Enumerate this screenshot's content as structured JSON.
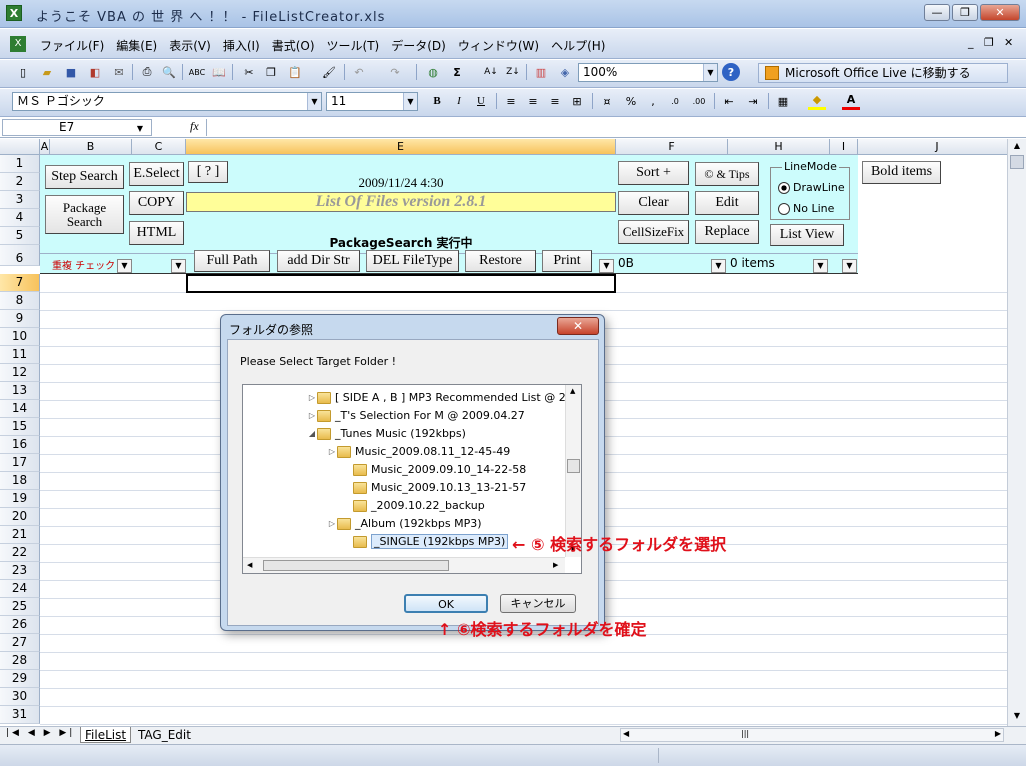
{
  "window": {
    "title": "ようこそ VBA の 世 界 へ ！！ - FileListCreator.xls"
  },
  "menu": [
    "ファイル(F)",
    "編集(E)",
    "表示(V)",
    "挿入(I)",
    "書式(O)",
    "ツール(T)",
    "データ(D)",
    "ウィンドウ(W)",
    "ヘルプ(H)"
  ],
  "toolbar": {
    "zoom": "100%",
    "office_live": "Microsoft Office Live に移動する",
    "font": "ＭＳ Ｐゴシック",
    "size": "11"
  },
  "formula": {
    "cell": "E7"
  },
  "columns": [
    "A",
    "B",
    "C",
    "E",
    "F",
    "H",
    "I",
    "J"
  ],
  "rows": [
    "1",
    "2",
    "3",
    "4",
    "5",
    "6",
    "7",
    "8",
    "9",
    "10",
    "11",
    "12",
    "13",
    "14",
    "15",
    "16",
    "17",
    "18",
    "19",
    "20",
    "21",
    "22",
    "23",
    "24",
    "25",
    "26",
    "27",
    "28",
    "29",
    "30",
    "31"
  ],
  "sheet": {
    "step_search": "Step Search",
    "package_search": "Package Search",
    "eselect": "E.Select",
    "copy": "COPY",
    "html": "HTML",
    "help": "[ ? ]",
    "datetime": "2009/11/24 4:30",
    "title": "List Of Files version 2.8.1",
    "status": "PackageSearch 実行中",
    "sort": "Sort +",
    "tips": "© & Tips",
    "clear": "Clear",
    "edit": "Edit",
    "cellsizefix": "CellSizeFix",
    "replace": "Replace",
    "linemode": "LineMode",
    "drawline": "DrawLine",
    "noline": "No Line",
    "listview": "List View",
    "bold": "Bold items",
    "dup_check": "重複 チェック",
    "fullpath": "Full Path",
    "adddir": "add Dir Str",
    "delfiletype": "DEL FileType",
    "restore": "Restore",
    "print": "Print",
    "size": "0B",
    "items": "0 items"
  },
  "dialog": {
    "title": "フォルダの参照",
    "prompt": "Please Select Target Folder !",
    "folders": [
      "[ SIDE A , B ] MP3 Recommended List @ 2",
      "_T's Selection For M @ 2009.04.27",
      "_Tunes Music (192kbps)",
      "Music_2009.08.11_12-45-49",
      "Music_2009.09.10_14-22-58",
      "Music_2009.10.13_13-21-57",
      "_2009.10.22_backup",
      "_Album (192kbps MP3)",
      "_SINGLE (192kbps MP3)"
    ],
    "ok": "OK",
    "cancel": "キャンセル"
  },
  "annotations": {
    "a5": "← ⑤ 検索するフォルダを選択",
    "a6": "↑ ⑥検索するフォルダを確定"
  },
  "tabs": {
    "t1": "FileList",
    "t2": "TAG_Edit"
  }
}
